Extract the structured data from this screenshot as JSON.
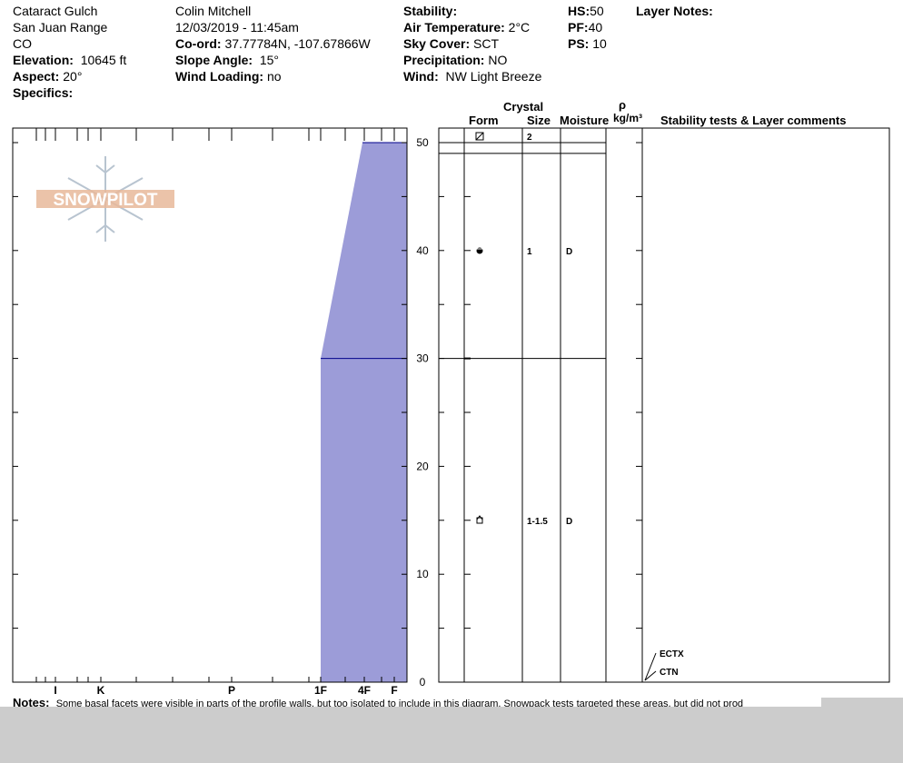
{
  "header": {
    "location": "Cataract Gulch",
    "range": "San Juan Range",
    "state": "CO",
    "elevation_label": "Elevation:",
    "elevation_value": "10645 ft",
    "aspect_label": "Aspect:",
    "aspect_value": "20°",
    "specifics_label": "Specifics:",
    "observer": "Colin Mitchell",
    "datetime": "12/03/2019 - 11:45am",
    "coord_label": "Co-ord:",
    "coord_value": "37.77784N, -107.67866W",
    "slope_label": "Slope Angle:",
    "slope_value": "15°",
    "wind_loading_label": "Wind Loading:",
    "wind_loading_value": "no",
    "stability_label": "Stability:",
    "air_temp_label": "Air Temperature:",
    "air_temp_value": "2°C",
    "sky_label": "Sky Cover:",
    "sky_value": "SCT",
    "precip_label": "Precipitation:",
    "precip_value": "NO",
    "wind_label": "Wind:",
    "wind_value": "NW Light Breeze",
    "hs_label": "HS:",
    "hs_value": "50",
    "pf_label": "PF:",
    "pf_value": "40",
    "ps_label": "PS:",
    "ps_value": "10",
    "layer_notes_label": "Layer Notes:"
  },
  "columns": {
    "crystal": "Crystal",
    "form": "Form",
    "size": "Size",
    "moisture": "Moisture",
    "rho": "ρ",
    "density_unit": "kg/m³",
    "stability": "Stability tests & Layer comments"
  },
  "notes": {
    "label": "Notes:",
    "text": "Some basal facets were visible in parts of the profile walls, but too isolated to include in this diagram.  Snowpack tests targeted these areas, but did not prod"
  },
  "logo_text": "SNOWPILOT",
  "colors": {
    "hardness_fill": "#9c9cd8",
    "hardness_edge": "#00008b",
    "logo": "#e8b89a",
    "flake": "#b8c4d0"
  },
  "chart_data": {
    "type": "area",
    "title": "",
    "xlabel": "",
    "ylabel": "",
    "y_ticks": [
      "0",
      "10",
      "20",
      "30",
      "40",
      "50"
    ],
    "ylim": [
      0,
      50
    ],
    "hardness_ticks": [
      "I",
      "K",
      "P",
      "1F",
      "4F",
      "F"
    ],
    "hardness_profile": [
      {
        "top": 50,
        "bottom": 30,
        "hardness_top": "F",
        "hardness_bottom": "1F"
      },
      {
        "top": 30,
        "bottom": 0,
        "hardness_top": "1F",
        "hardness_bottom": "1F"
      }
    ],
    "layers": [
      {
        "top": 50,
        "bottom": 49,
        "form": "decomposing-fragments",
        "size": "2",
        "moisture": ""
      },
      {
        "top": 49,
        "bottom": 30,
        "form": "rounded-grains",
        "size": "1",
        "moisture": "D"
      },
      {
        "top": 30,
        "bottom": 0,
        "form": "faceted-crystals",
        "size": "1-1.5",
        "moisture": "D"
      }
    ],
    "stability_tests": [
      {
        "label": "ECTX",
        "height": 0
      },
      {
        "label": "CTN",
        "height": 0
      }
    ]
  }
}
